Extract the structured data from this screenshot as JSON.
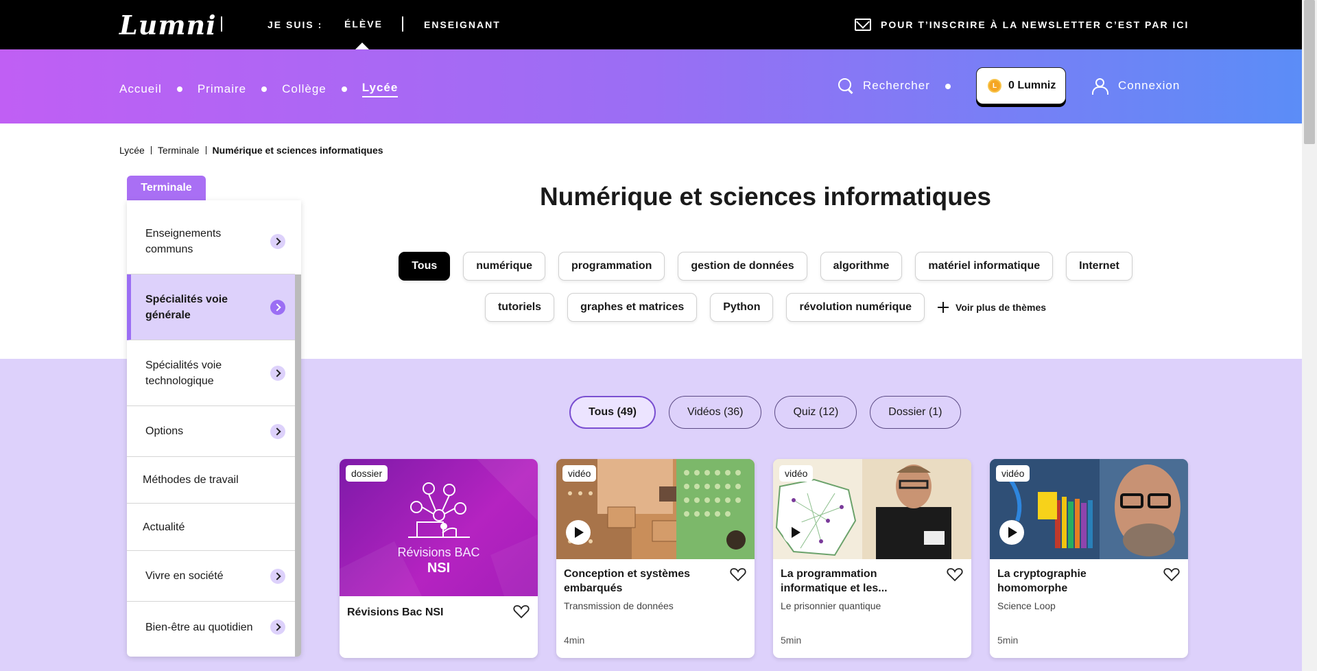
{
  "topbar": {
    "logo": "Lumni",
    "je_suis": "JE SUIS :",
    "eleve": "ÉLÈVE",
    "enseignant": "ENSEIGNANT",
    "newsletter": "POUR T’INSCRIRE À LA NEWSLETTER C’EST PAR ICI"
  },
  "nav": {
    "items": [
      "Accueil",
      "Primaire",
      "Collège",
      "Lycée"
    ],
    "active": "Lycée",
    "search": "Rechercher",
    "lumniz": "0 Lumniz",
    "coin": "L",
    "connexion": "Connexion"
  },
  "breadcrumb": [
    "Lycée",
    "Terminale",
    "Numérique et sciences informatiques"
  ],
  "sidebar": {
    "tab": "Terminale",
    "items": [
      {
        "label": "Enseignements communs",
        "chevron": true
      },
      {
        "label": "Spécialités voie générale",
        "chevron": true,
        "active": true
      },
      {
        "label": "Spécialités voie technologique",
        "chevron": true
      },
      {
        "label": "Options",
        "chevron": true
      },
      {
        "label": "Méthodes de travail",
        "chevron": false
      },
      {
        "label": "Actualité",
        "chevron": false
      },
      {
        "label": "Vivre en société",
        "chevron": true
      },
      {
        "label": "Bien-être au quotidien",
        "chevron": true
      }
    ]
  },
  "page_title": "Numérique et sciences informatiques",
  "tags_row1": [
    "Tous",
    "numérique",
    "programmation",
    "gestion de données",
    "algorithme",
    "matériel informatique",
    "Internet"
  ],
  "tags_row2": [
    "tutoriels",
    "graphes et matrices",
    "Python",
    "révolution numérique"
  ],
  "voir_plus": "Voir plus de thèmes",
  "filters": [
    "Tous (49)",
    "Vidéos (36)",
    "Quiz (12)",
    "Dossier (1)"
  ],
  "cards": [
    {
      "type": "dossier",
      "title": "Révisions Bac NSI",
      "subtitle": "",
      "duration": "",
      "thumb_text": "Révisions BAC",
      "thumb_text2": "NSI"
    },
    {
      "type": "vidéo",
      "title": "Conception et systèmes embarqués",
      "subtitle": "Transmission de données",
      "duration": "4min"
    },
    {
      "type": "vidéo",
      "title": "La programmation informatique et les...",
      "subtitle": "Le prisonnier quantique",
      "duration": "5min"
    },
    {
      "type": "vidéo",
      "title": "La cryptographie homomorphe",
      "subtitle": "Science Loop",
      "duration": "5min"
    }
  ],
  "colors": {
    "accent": "#9b6ef4",
    "lilac": "#ddd1fb",
    "black": "#000000"
  }
}
